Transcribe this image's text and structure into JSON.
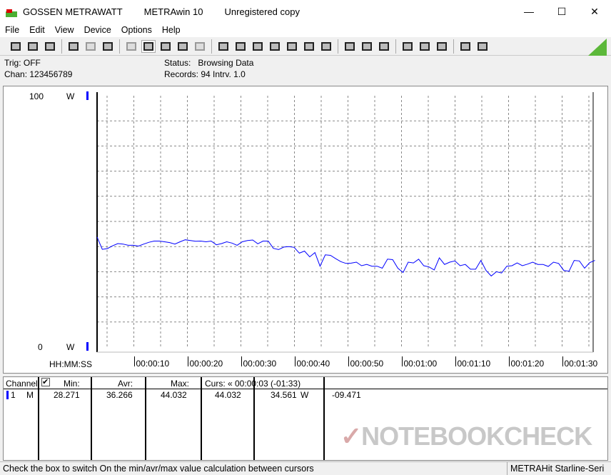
{
  "window": {
    "title_parts": [
      "GOSSEN METRAWATT",
      "METRAwin 10",
      "Unregistered copy"
    ],
    "minimize": "—",
    "maximize": "☐",
    "close": "✕"
  },
  "menu": [
    "File",
    "Edit",
    "View",
    "Device",
    "Options",
    "Help"
  ],
  "toolbar": {
    "icons": [
      "save-icon",
      "save-as-icon",
      "open-icon",
      "device-read-icon",
      "device-read-disabled-icon",
      "memory-read-icon",
      "numeric-view-icon",
      "chart-view-icon",
      "xy-view-icon",
      "table-view-icon",
      "histogram-icon",
      "transfer-icon",
      "import-icon",
      "settings-icon",
      "monitor-icon",
      "function-icon",
      "device-icon",
      "waveform-icon",
      "trigger-icon",
      "zoom-icon",
      "target-icon",
      "print-icon",
      "print-preview-icon",
      "cursor-icon",
      "cursor-zoom-icon",
      "message-icon"
    ],
    "accent": "#5cb83a"
  },
  "info": {
    "trig": "Trig: OFF",
    "chan": "Chan:  123456789",
    "status_label": "Status:",
    "status_value": "Browsing Data",
    "records": "Records: 94   Intrv. 1.0"
  },
  "chart_data": {
    "type": "line",
    "ylim": [
      0,
      100
    ],
    "y_top_label": "100",
    "y_bottom_label": "0",
    "unit": "W",
    "x_axis_label": "HH:MM:SS",
    "xlim_seconds": [
      3,
      96
    ],
    "x_ticks": [
      {
        "t": 10,
        "label": "00:00:10"
      },
      {
        "t": 20,
        "label": "00:00:20"
      },
      {
        "t": 30,
        "label": "00:00:30"
      },
      {
        "t": 40,
        "label": "00:00:40"
      },
      {
        "t": 50,
        "label": "00:00:50"
      },
      {
        "t": 60,
        "label": "00:01:00"
      },
      {
        "t": 70,
        "label": "00:01:10"
      },
      {
        "t": 80,
        "label": "00:01:20"
      },
      {
        "t": 90,
        "label": "00:01:30"
      }
    ],
    "grid": true,
    "series_color": "#0000ff",
    "values": [
      43.8,
      38.9,
      39.2,
      40.3,
      41.2,
      41.0,
      40.5,
      40.5,
      40.2,
      41.0,
      41.7,
      42.2,
      42.2,
      41.9,
      41.6,
      41.0,
      41.9,
      42.7,
      42.4,
      42.1,
      42.2,
      41.9,
      42.2,
      40.7,
      41.2,
      41.9,
      41.4,
      40.5,
      41.9,
      42.4,
      42.6,
      41.1,
      42.2,
      42.2,
      39.3,
      38.8,
      39.8,
      40.0,
      39.7,
      37.4,
      38.2,
      35.9,
      37.6,
      32.2,
      36.7,
      36.5,
      35.2,
      34.0,
      33.3,
      33.4,
      33.8,
      32.4,
      32.9,
      32.2,
      32.2,
      31.4,
      35.0,
      34.8,
      31.4,
      29.7,
      33.8,
      33.5,
      35.0,
      32.4,
      31.9,
      30.7,
      35.5,
      32.9,
      33.8,
      34.3,
      32.4,
      32.9,
      31.0,
      31.0,
      34.5,
      30.5,
      28.3,
      30.0,
      29.5,
      32.2,
      32.4,
      33.5,
      32.4,
      33.0,
      33.8,
      32.9,
      32.9,
      32.1,
      33.8,
      33.3,
      30.5,
      30.2,
      34.5,
      34.3,
      31.4,
      33.6,
      34.5
    ]
  },
  "table": {
    "headers": {
      "channel": "Channel:",
      "min": "Min:",
      "avr": "Avr:",
      "max": "Max:",
      "curs": "Curs: « 00:00:03 (-01:33)"
    },
    "checkbox_checked": true,
    "row": {
      "num": "1",
      "mode": "M",
      "min": "28.271",
      "avr": "36.266",
      "max": "44.032",
      "curs1": "44.032",
      "curs2": "34.561",
      "unit": "W",
      "diff": "-09.471"
    }
  },
  "watermark": "NOTEBOOKCHECK",
  "status": {
    "hint": "Check the box to switch On the min/avr/max value calculation between cursors",
    "device": "METRAHit Starline-Seri"
  }
}
